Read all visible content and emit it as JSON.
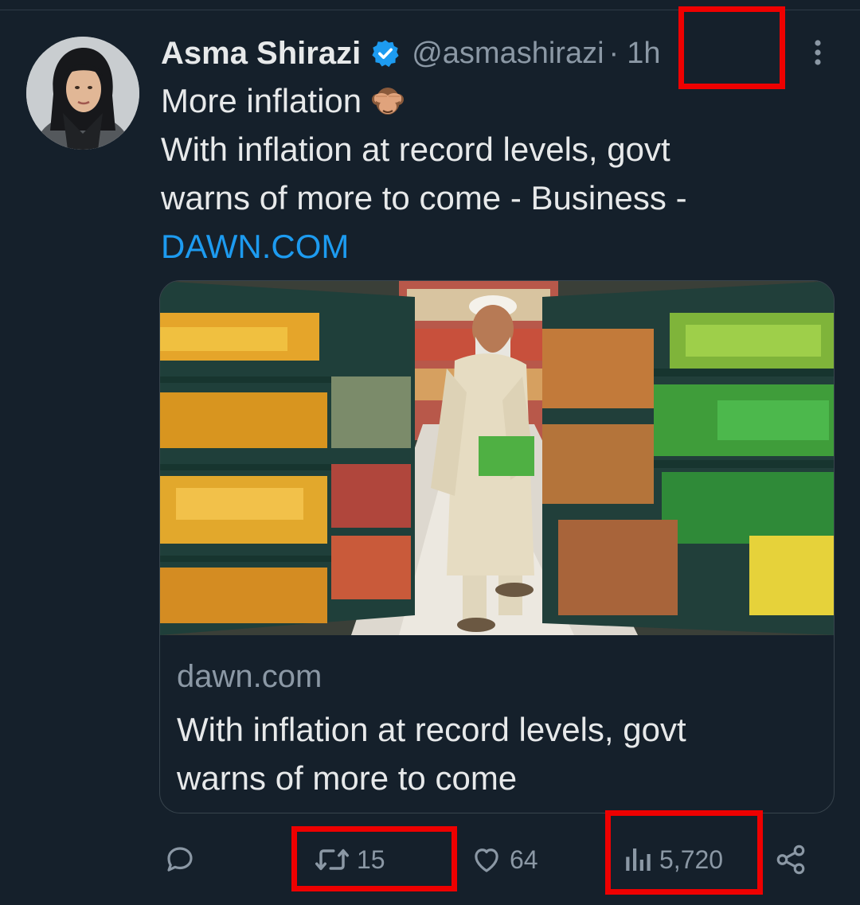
{
  "tweet": {
    "author_name": "Asma Shirazi",
    "handle": "@asmashirazi",
    "separator": "·",
    "time": "1h",
    "text_line1": "More inflation",
    "text_line2": "With inflation at record levels, govt",
    "text_line3": "warns of more to come - Business -",
    "link_text": "DAWN.COM",
    "emoji": "see-no-evil-monkey-icon"
  },
  "card": {
    "domain": "dawn.com",
    "title_line1": "With inflation at record levels, govt",
    "title_line2": "warns of more to come"
  },
  "actions": {
    "reply_count": "",
    "retweet_count": "15",
    "like_count": "64",
    "views_count": "5,720"
  },
  "colors": {
    "background": "#15202b",
    "text": "#e7e9ea",
    "secondary_text": "#8b98a5",
    "link": "#1d9bf0",
    "verified": "#1d9bf0",
    "highlight_box": "#ee0000"
  }
}
